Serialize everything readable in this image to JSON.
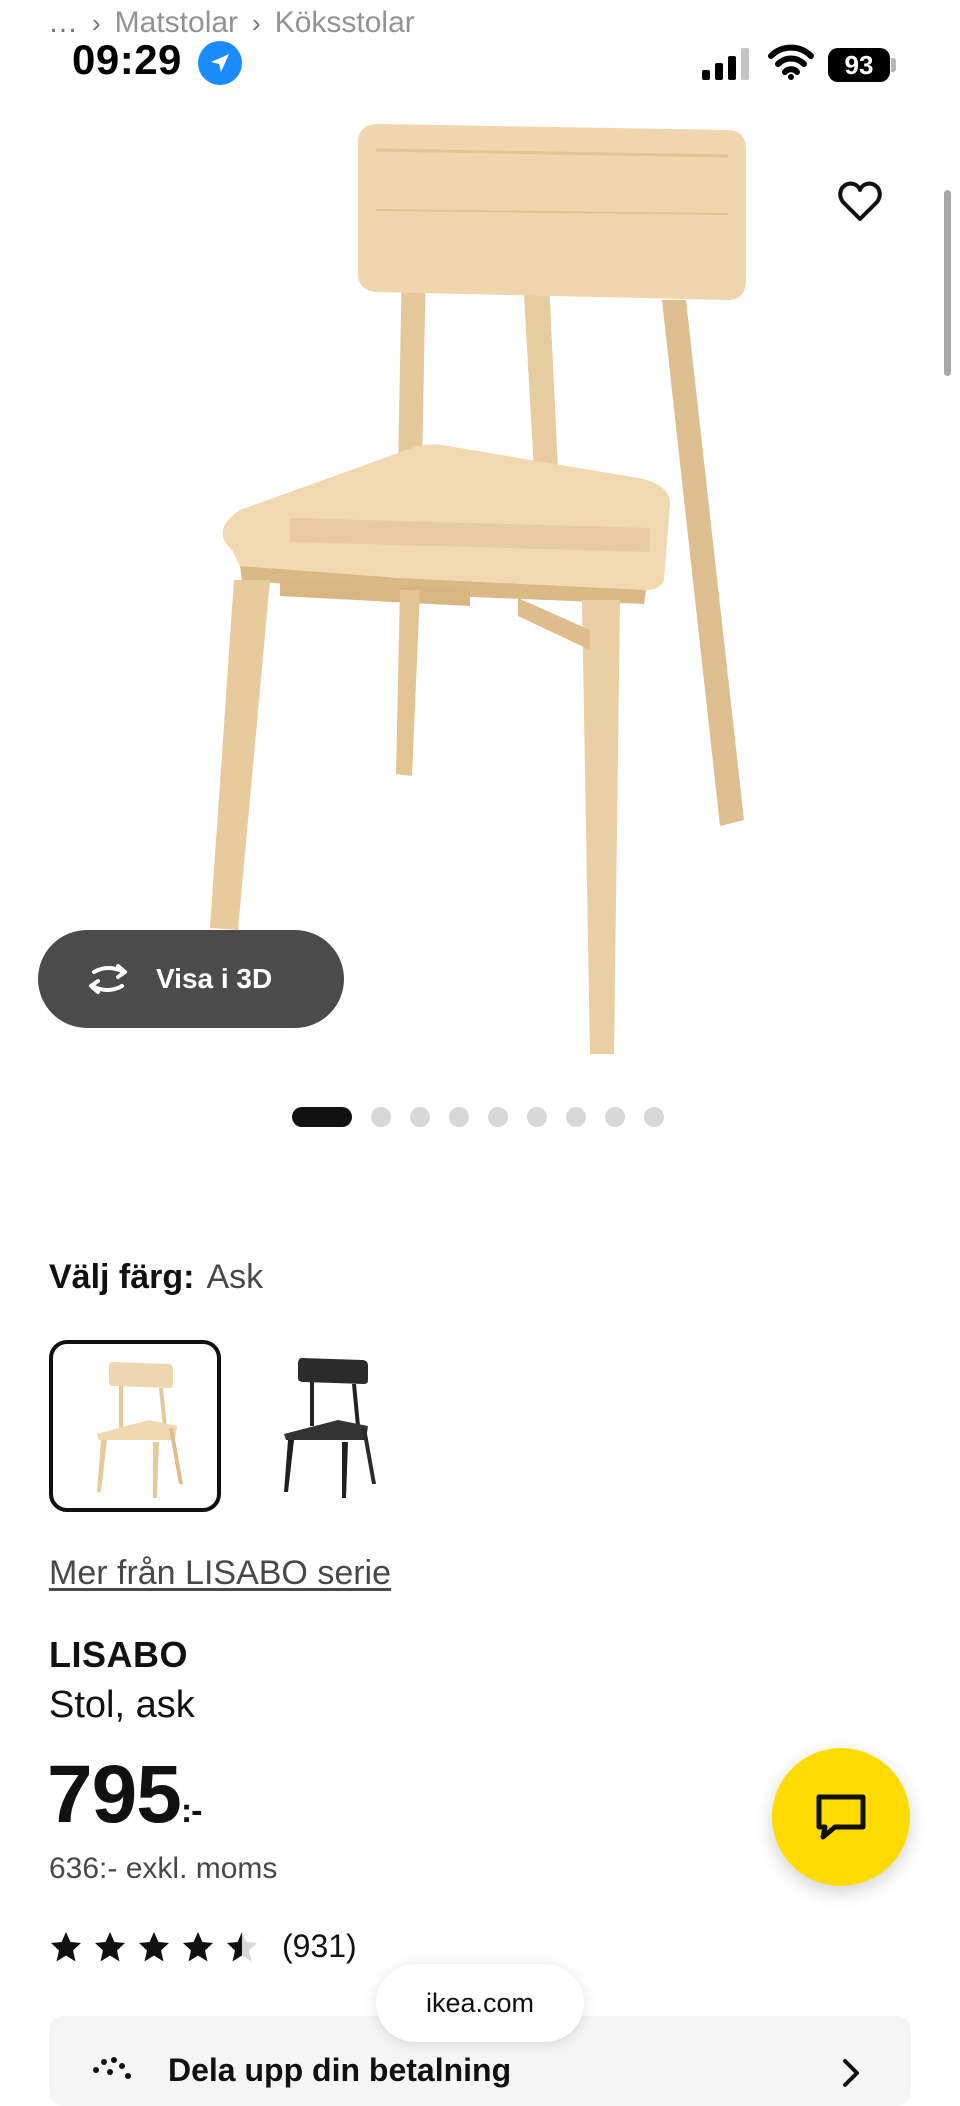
{
  "breadcrumb": {
    "ellipsis": "…",
    "items": [
      "Matstolar",
      "Köksstolar"
    ]
  },
  "status_bar": {
    "time": "09:29",
    "battery": "93"
  },
  "gallery": {
    "view_3d_label": "Visa i 3D",
    "total_images": 9,
    "active_index": 0
  },
  "color_selection": {
    "label": "Välj färg:",
    "value": "Ask",
    "options": [
      "Ask",
      "Svart"
    ]
  },
  "series_link": "Mer från LISABO serie",
  "product": {
    "brand": "LISABO",
    "description": "Stol, ask",
    "price": "795",
    "price_suffix": ":-",
    "price_excl_vat": "636:- exkl. moms",
    "rating": 4.5,
    "rating_count": "(931)"
  },
  "browser": {
    "url": "ikea.com"
  },
  "payment_banner": {
    "label": "Dela upp din betalning"
  },
  "colors": {
    "chat_fab": "#ffdb00",
    "location_badge": "#1a8cff",
    "text": "#111111"
  }
}
